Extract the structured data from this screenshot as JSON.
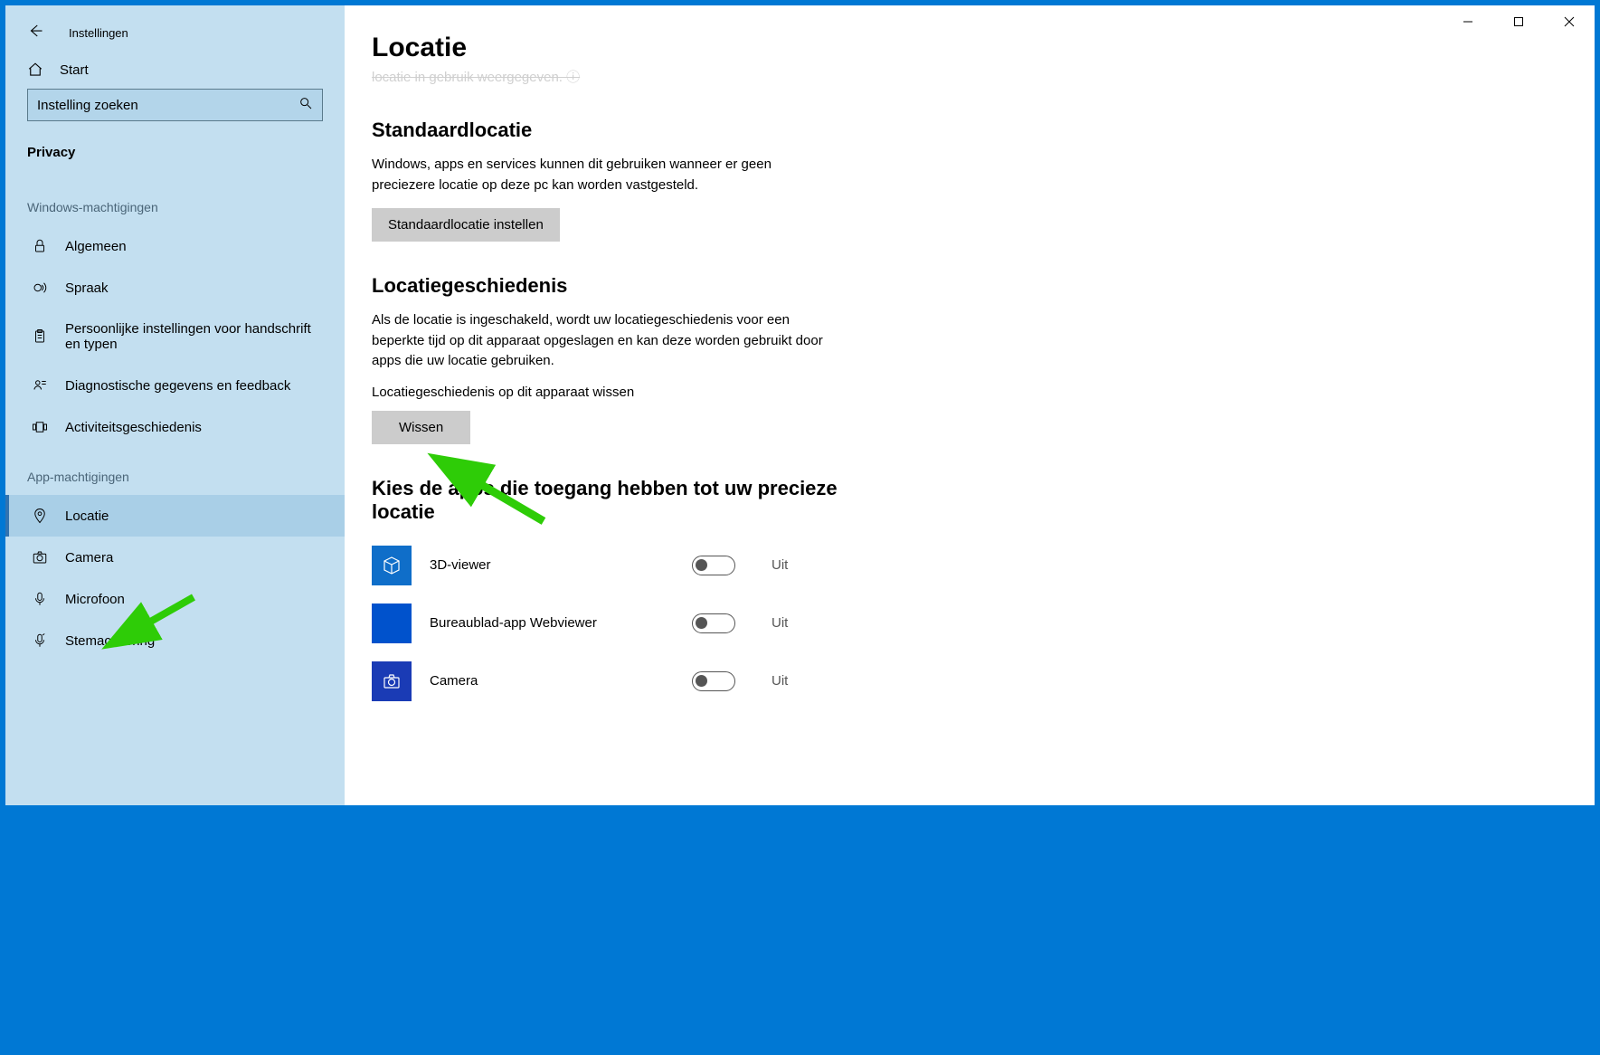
{
  "window": {
    "title": "Instellingen"
  },
  "sidebar": {
    "home": "Start",
    "search_placeholder": "Instelling zoeken",
    "category": "Privacy",
    "groups": [
      {
        "header": "Windows-machtigingen",
        "items": [
          {
            "id": "algemeen",
            "label": "Algemeen",
            "icon": "lock"
          },
          {
            "id": "spraak",
            "label": "Spraak",
            "icon": "speech"
          },
          {
            "id": "inkt",
            "label": "Persoonlijke instellingen voor handschrift en typen",
            "icon": "clipboard"
          },
          {
            "id": "diag",
            "label": "Diagnostische gegevens en feedback",
            "icon": "feedback"
          },
          {
            "id": "act",
            "label": "Activiteitsgeschiedenis",
            "icon": "history"
          }
        ]
      },
      {
        "header": "App-machtigingen",
        "items": [
          {
            "id": "locatie",
            "label": "Locatie",
            "icon": "location",
            "active": true
          },
          {
            "id": "camera",
            "label": "Camera",
            "icon": "camera"
          },
          {
            "id": "microfoon",
            "label": "Microfoon",
            "icon": "mic"
          },
          {
            "id": "stem",
            "label": "Stemactivering",
            "icon": "voice"
          }
        ]
      }
    ]
  },
  "content": {
    "page_title": "Locatie",
    "cutoff_line": "locatie in gebruik weergegeven. ⓘ",
    "section_default": {
      "heading": "Standaardlocatie",
      "desc": "Windows, apps en services kunnen dit gebruiken wanneer er geen preciezere locatie op deze pc kan worden vastgesteld.",
      "button": "Standaardlocatie instellen"
    },
    "section_history": {
      "heading": "Locatiegeschiedenis",
      "desc": "Als de locatie is ingeschakeld, wordt uw locatiegeschiedenis voor een beperkte tijd op dit apparaat opgeslagen en kan deze worden gebruikt door apps die uw locatie gebruiken.",
      "clear_label": "Locatiegeschiedenis op dit apparaat wissen",
      "clear_button": "Wissen"
    },
    "section_apps": {
      "heading": "Kies de apps die toegang hebben tot uw precieze locatie",
      "toggle_off": "Uit",
      "apps": [
        {
          "name": "3D-viewer",
          "icon": "viewer",
          "state": "Uit"
        },
        {
          "name": "Bureaublad-app Webviewer",
          "icon": "web",
          "state": "Uit"
        },
        {
          "name": "Camera",
          "icon": "cam",
          "state": "Uit"
        }
      ]
    }
  }
}
